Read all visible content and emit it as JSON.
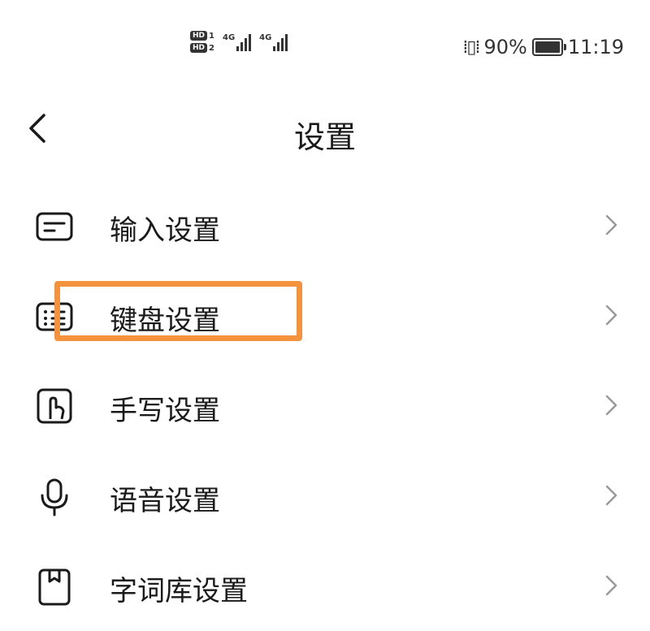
{
  "status_bar": {
    "sim1_badge": "HD",
    "sim1_num": "1",
    "sim2_badge": "HD",
    "sim2_num": "2",
    "net1": "4G",
    "net2": "4G",
    "battery": "90%",
    "time": "11:19"
  },
  "header": {
    "title": "设置",
    "back_icon": "chevron-left-icon"
  },
  "settings_list": [
    {
      "label": "输入设置",
      "icon": "input-box-icon"
    },
    {
      "label": "键盘设置",
      "icon": "keyboard-icon"
    },
    {
      "label": "手写设置",
      "icon": "handwriting-icon"
    },
    {
      "label": "语音设置",
      "icon": "microphone-icon"
    },
    {
      "label": "字词库设置",
      "icon": "dictionary-icon"
    }
  ],
  "colors": {
    "highlight": "#f5923e",
    "text": "#1a1a1a",
    "chevron": "#9a9a9a"
  }
}
